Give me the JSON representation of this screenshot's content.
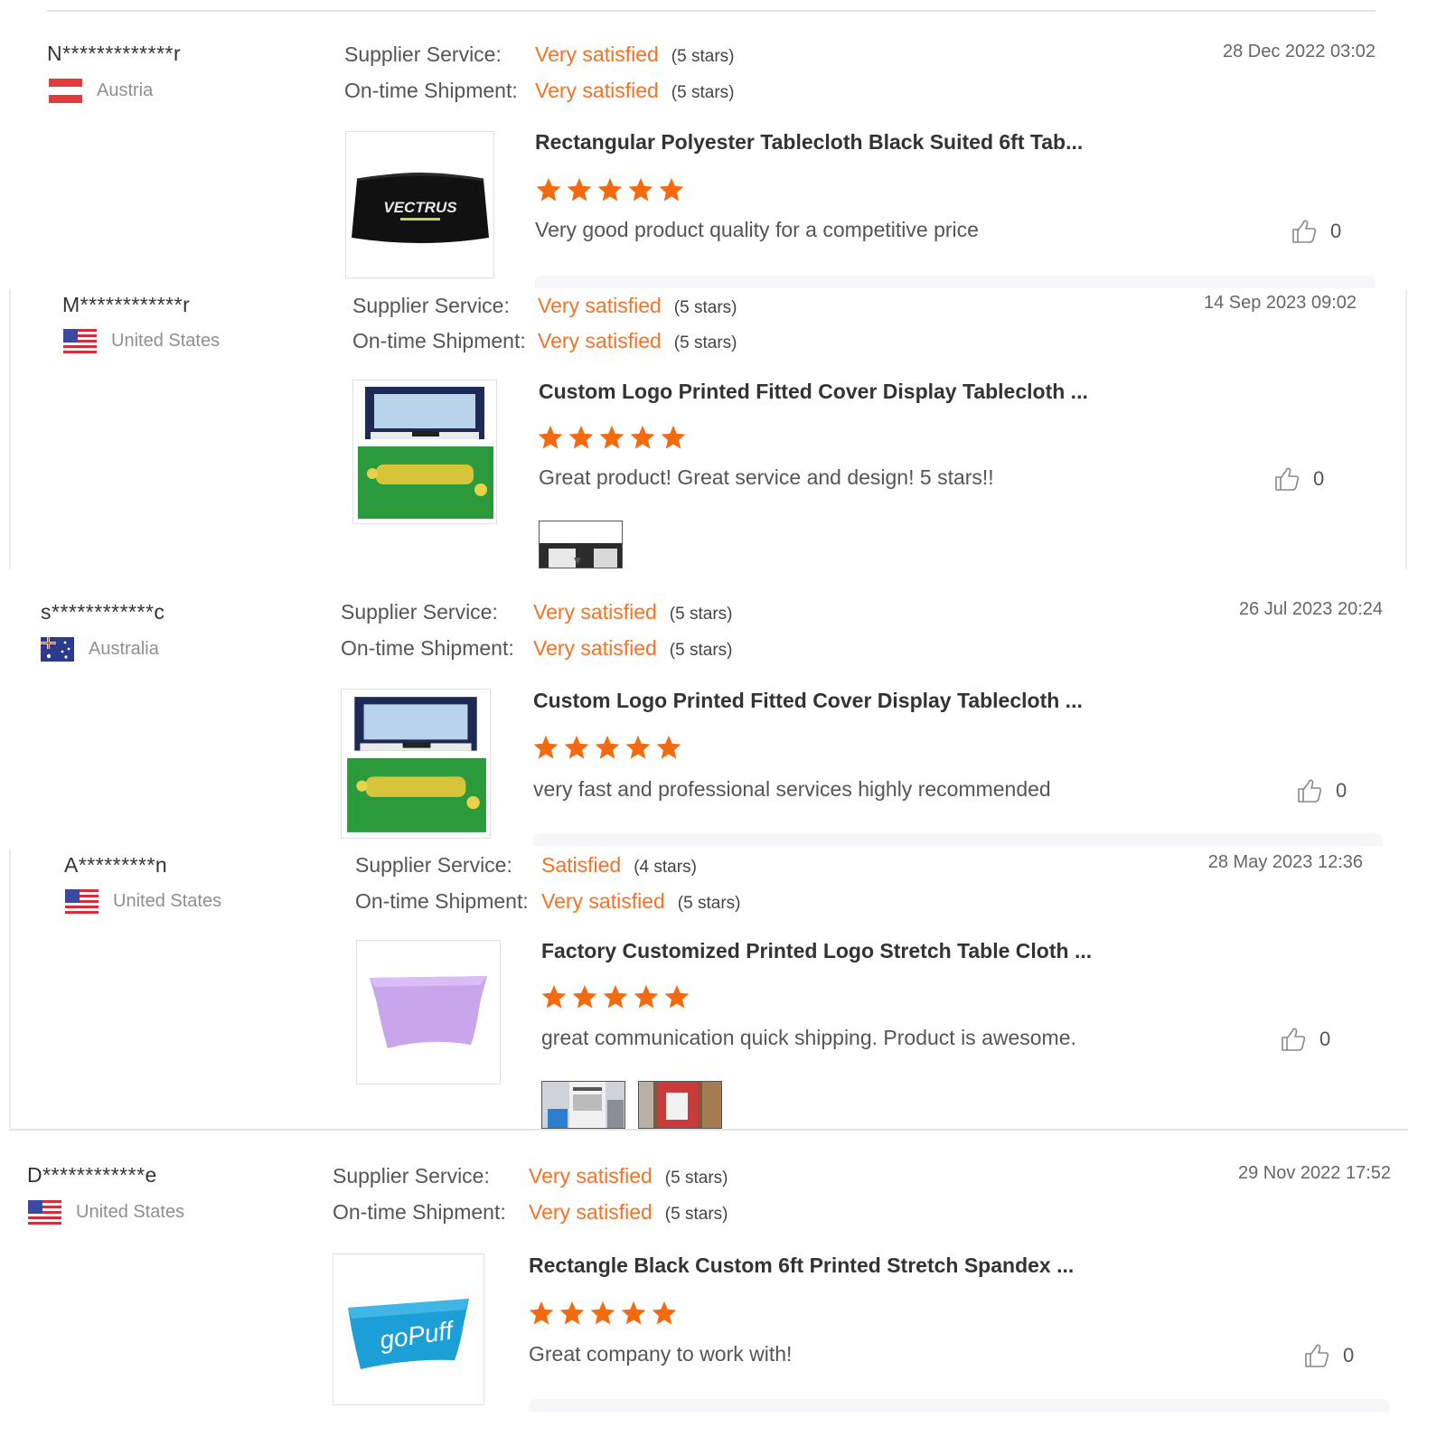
{
  "labels": {
    "supplier_service": "Supplier Service:",
    "ontime_shipment": "On-time Shipment:"
  },
  "colors": {
    "rating_text": "#f57224",
    "star": "#f56a0f"
  },
  "reviews": [
    {
      "user": "N*************r",
      "country": "Austria",
      "flag": "austria-flag",
      "supplier_rating": "Very satisfied",
      "supplier_stars": "(5 stars)",
      "shipment_rating": "Very satisfied",
      "shipment_stars": "(5 stars)",
      "date": "28 Dec 2022 03:02",
      "product_title": "Rectangular Polyester Tablecloth Black Suited 6ft Tab...",
      "product_image": "black tablecloth with VECTRUS logo",
      "product_logo_text": "VECTRUS",
      "stars": 5,
      "comment": "Very good product quality for a competitive price",
      "likes": "0"
    },
    {
      "user": "M************r",
      "country": "United States",
      "flag": "usa-flag",
      "supplier_rating": "Very satisfied",
      "supplier_stars": "(5 stars)",
      "shipment_rating": "Very satisfied",
      "shipment_stars": "(5 stars)",
      "date": "14 Sep 2023 09:02",
      "product_title": "Custom Logo Printed Fitted Cover Display Tablecloth ...",
      "product_image": "green printed fitted tablecloth",
      "stars": 5,
      "comment": "Great product! Great service and design! 5 stars!!",
      "likes": "0"
    },
    {
      "user": "s************c",
      "country": "Australia",
      "flag": "australia-flag",
      "supplier_rating": "Very satisfied",
      "supplier_stars": "(5 stars)",
      "shipment_rating": "Very satisfied",
      "shipment_stars": "(5 stars)",
      "date": "26 Jul 2023 20:24",
      "product_title": "Custom Logo Printed Fitted Cover Display Tablecloth ...",
      "product_image": "green printed fitted tablecloth",
      "stars": 5,
      "comment": "very fast and professional services highly recommended",
      "likes": "0"
    },
    {
      "user": "A*********n",
      "country": "United States",
      "flag": "usa-flag",
      "supplier_rating": "Satisfied",
      "supplier_stars": "(4 stars)",
      "shipment_rating": "Very satisfied",
      "shipment_stars": "(5 stars)",
      "date": "28 May 2023 12:36",
      "product_title": "Factory Customized Printed Logo Stretch Table Cloth ...",
      "product_image": "lilac stretch table cloth",
      "stars": 5,
      "comment": "great communication quick shipping. Product is awesome.",
      "likes": "0"
    },
    {
      "user": "D************e",
      "country": "United States",
      "flag": "usa-flag",
      "supplier_rating": "Very satisfied",
      "supplier_stars": "(5 stars)",
      "shipment_rating": "Very satisfied",
      "shipment_stars": "(5 stars)",
      "date": "29 Nov 2022 17:52",
      "product_title": "Rectangle Black Custom 6ft Printed Stretch Spandex ...",
      "product_image": "blue stretch table cover with goPuff logo",
      "product_logo_text": "goPuff",
      "stars": 5,
      "comment": "Great company to work with!",
      "likes": "0"
    }
  ]
}
